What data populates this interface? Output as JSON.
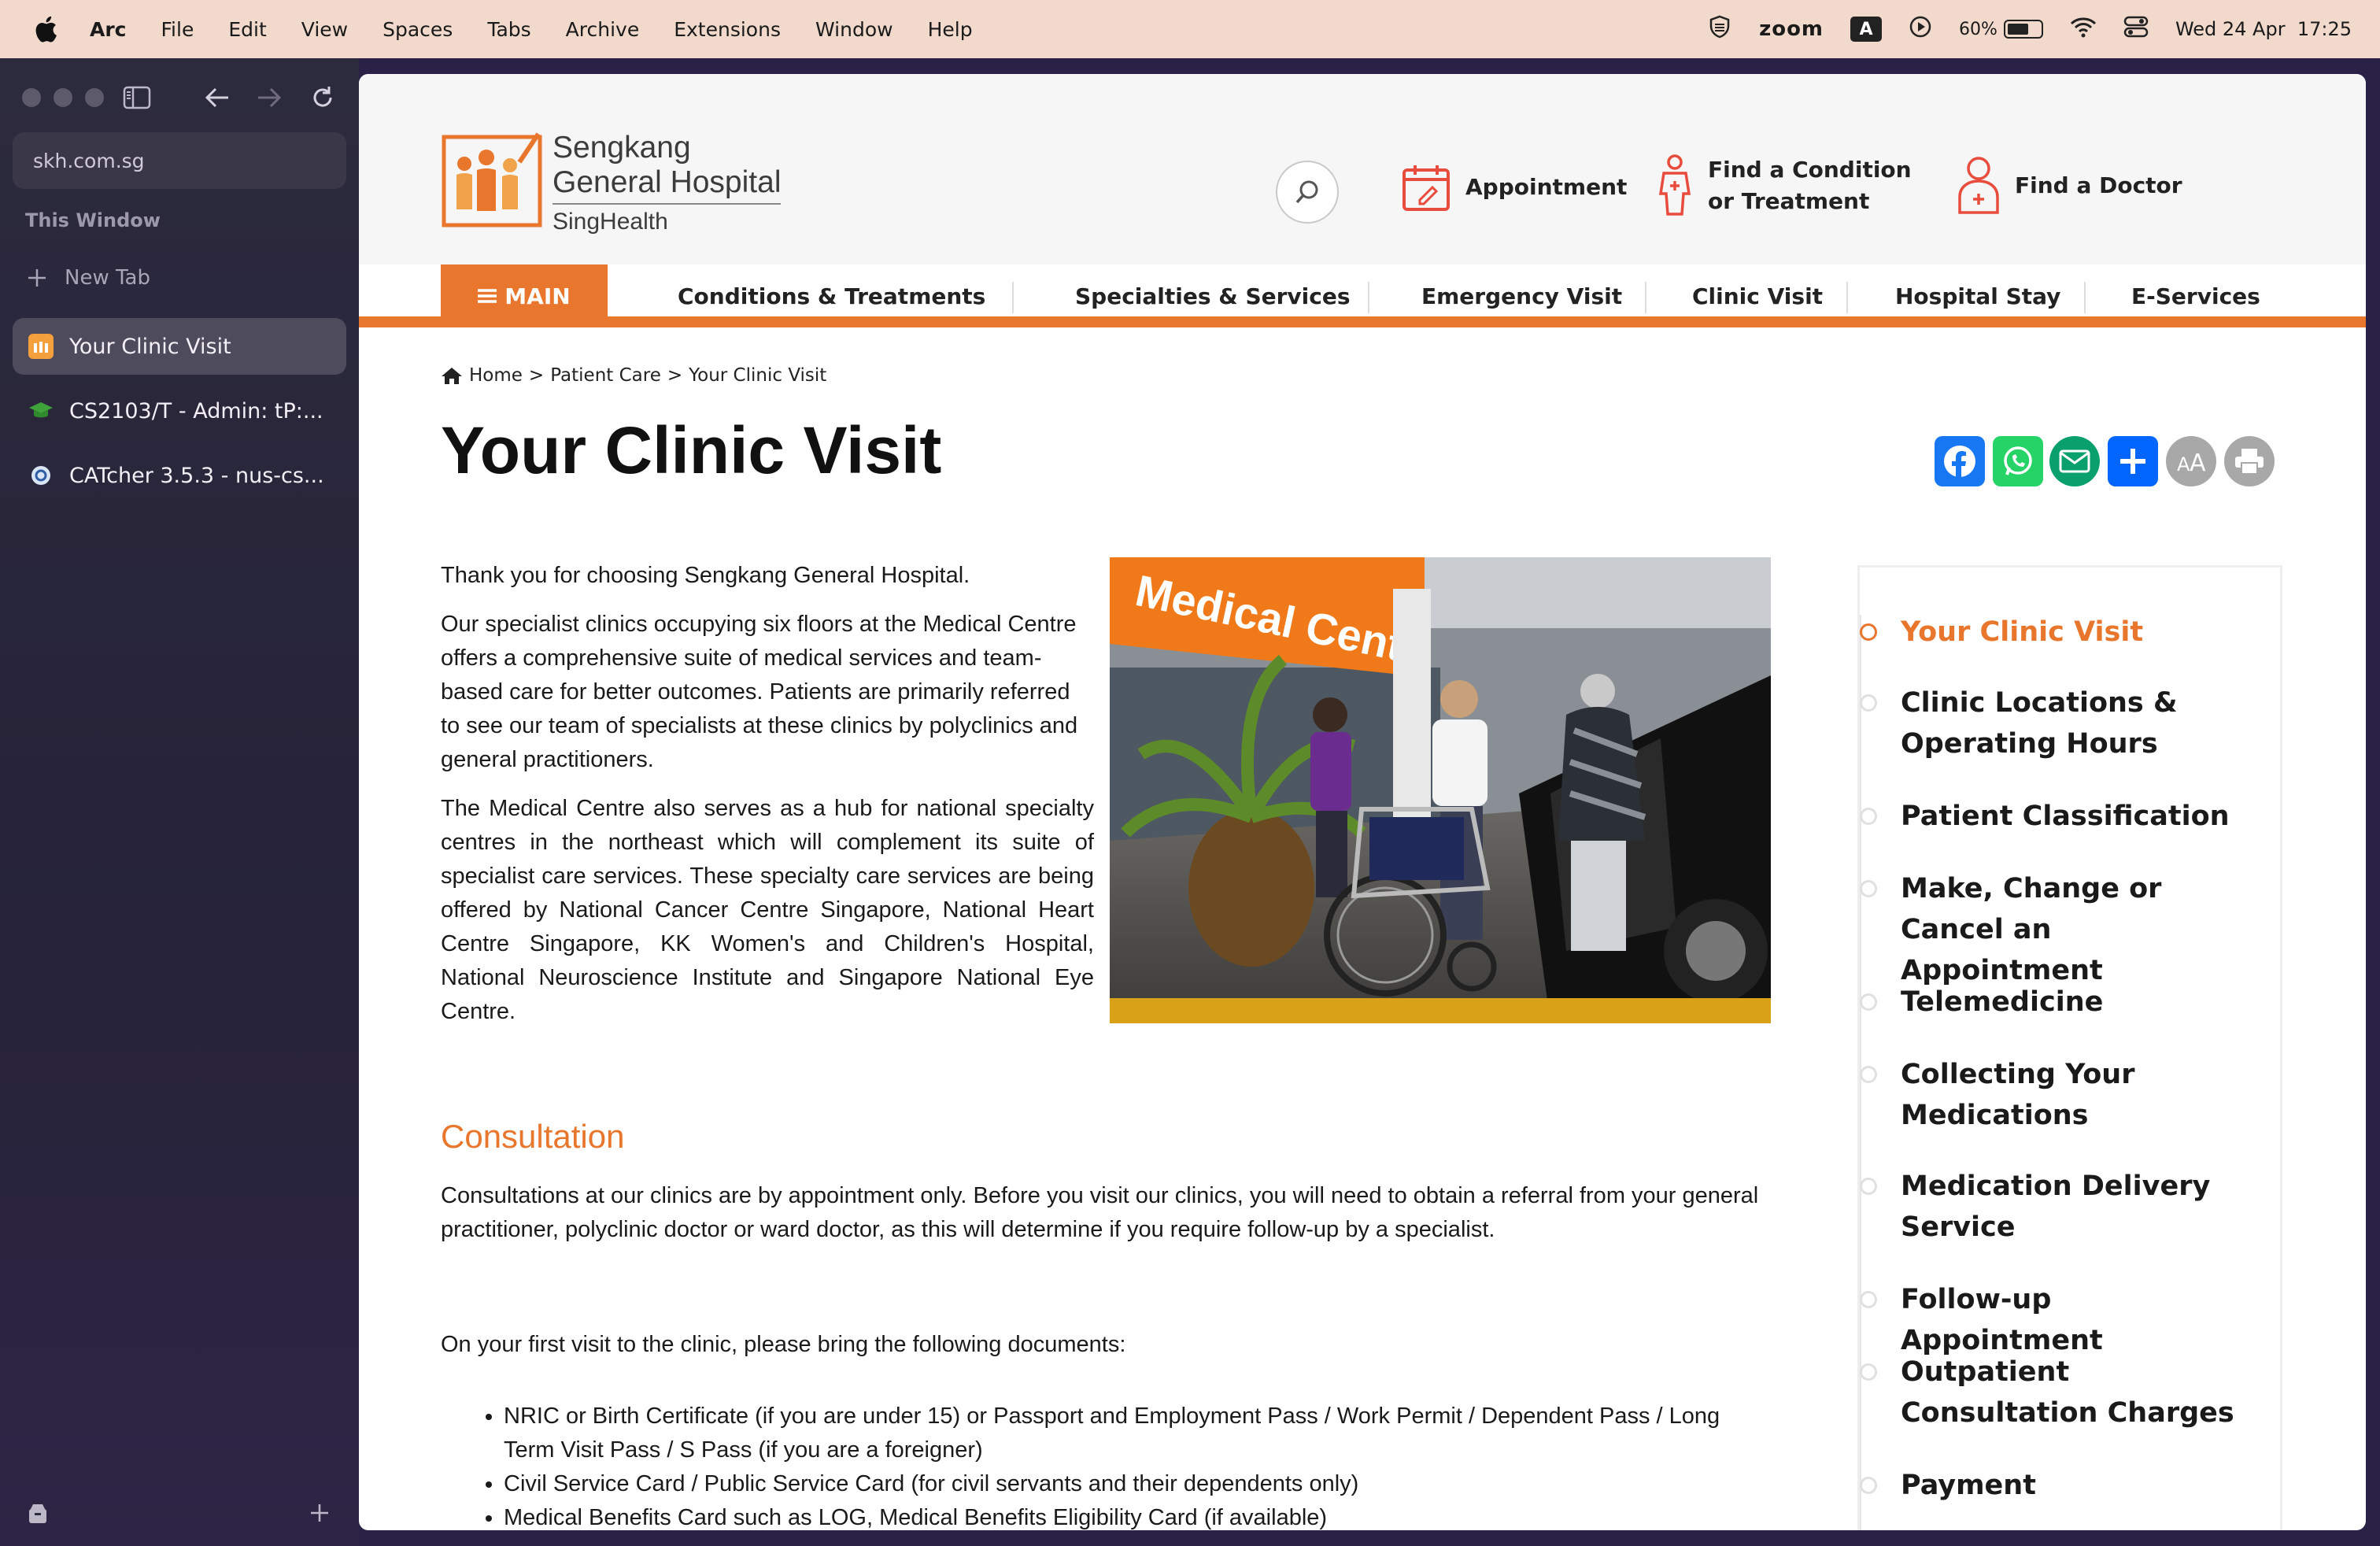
{
  "menubar": {
    "items": [
      "Arc",
      "File",
      "Edit",
      "View",
      "Spaces",
      "Tabs",
      "Archive",
      "Extensions",
      "Window",
      "Help"
    ],
    "zoom_label": "zoom",
    "keyboard_label": "A",
    "battery": "60%",
    "datetime": "Wed 24 Apr  17:25"
  },
  "sidebar": {
    "url": "skh.com.sg",
    "section_label": "This Window",
    "new_tab_label": "New Tab",
    "tabs": [
      {
        "title": "Your Clinic Visit",
        "active": true
      },
      {
        "title": "CS2103/T - Admin: tP:...",
        "active": false
      },
      {
        "title": "CATcher 3.5.3 - nus-cs...",
        "active": false
      }
    ]
  },
  "site": {
    "logo": {
      "line1": "Sengkang",
      "line2": "General Hospital",
      "line3": "SingHealth"
    },
    "header_links": {
      "appointment": "Appointment",
      "find_condition_1": "Find a Condition",
      "find_condition_2": "or Treatment",
      "find_doctor": "Find a Doctor"
    },
    "nav": {
      "main": "MAIN",
      "items": [
        "Conditions & Treatments",
        "Specialties & Services",
        "Emergency Visit",
        "Clinic Visit",
        "Hospital Stay",
        "E-Services"
      ]
    },
    "breadcrumb": {
      "home": "Home",
      "sep1": ">",
      "patient_care": "Patient Care",
      "sep2": ">",
      "current": "Your Clinic Visit"
    },
    "title": "Your Clinic Visit",
    "share_icons": [
      "facebook-icon",
      "whatsapp-icon",
      "email-icon",
      "share-plus-icon",
      "font-size-icon",
      "print-icon"
    ],
    "photo_sign": "Medical Cent",
    "intro": "Thank you for choosing Sengkang General Hospital.",
    "para1": "Our specialist clinics occupying six floors at the Medical Centre offers a comprehensive suite of medical services and team-based care for better outcomes. Patients are primarily referred to see our team of specialists at these clinics by polyclinics and general practitioners.",
    "para2": "The Medical Centre also serves as a hub for national specialty centres in the northeast which will complement its suite of specialist care services. These specialty care services are being offered by National Cancer Centre Singapore, National Heart Centre Singapore, KK Women's and Children's Hospital, National Neuroscience Institute and Singapore National Eye Centre.",
    "consultation_heading": "Consultation",
    "consultation_text": "Consultations at our clinics are by appointment only. Before you visit our clinics, you will need to obtain a referral from your general practitioner, polyclinic doctor or ward doctor, as this will determine if you require follow-up by a specialist.",
    "first_visit": "On your first visit to the clinic, please bring the following documents:",
    "documents": [
      "NRIC or Birth Certificate (if you are under 15) or Passport and Employment Pass / Work Permit / Dependent Pass / Long Term Visit Pass / S Pass (if you are a foreigner)",
      "Civil Service Card / Public Service Card (for civil servants and their dependents only)",
      "Medical Benefits Card such as LOG, Medical Benefits Eligibility Card (if available)"
    ],
    "side_nav": [
      {
        "label": "Your Clinic Visit",
        "active": true
      },
      {
        "label": "Clinic Locations & Operating Hours",
        "active": false
      },
      {
        "label": "Patient Classification",
        "active": false
      },
      {
        "label": "Make, Change or Cancel an Appointment",
        "active": false
      },
      {
        "label": "Telemedicine",
        "active": false
      },
      {
        "label": "Collecting Your Medications",
        "active": false
      },
      {
        "label": "Medication Delivery Service",
        "active": false
      },
      {
        "label": "Follow-up Appointment",
        "active": false
      },
      {
        "label": "Outpatient Consultation Charges",
        "active": false
      },
      {
        "label": "Payment",
        "active": false
      }
    ],
    "colors": {
      "accent": "#e8762c",
      "sidebar_bg": "#2c2a3d",
      "menubar_bg": "#f1d9cc"
    }
  }
}
